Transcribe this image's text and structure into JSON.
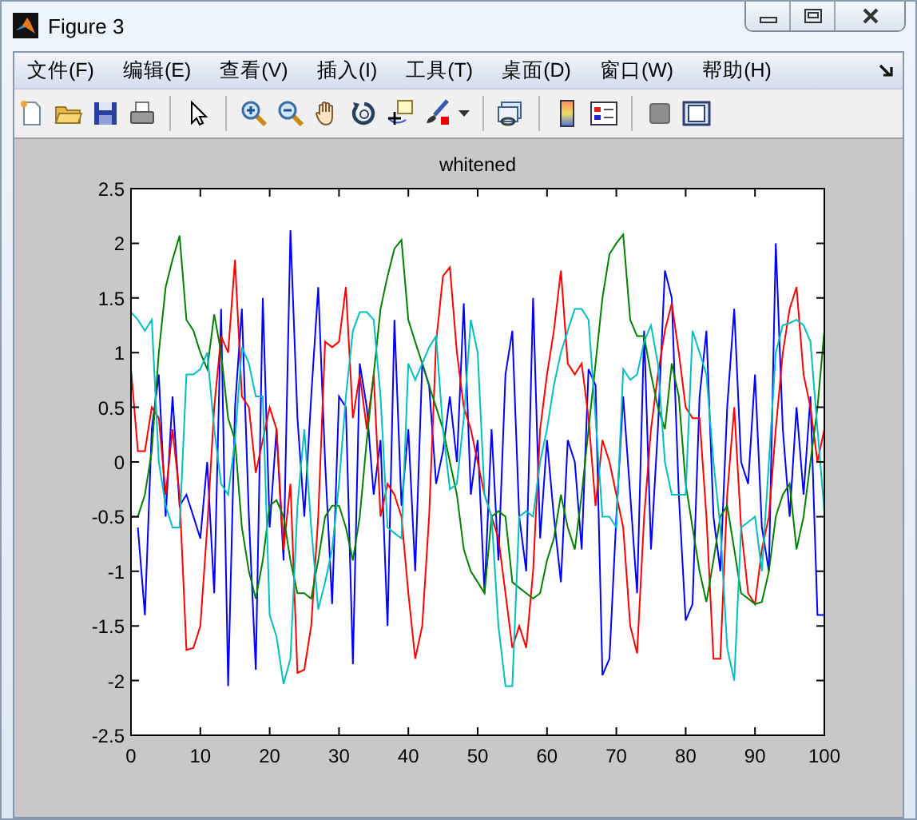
{
  "window": {
    "title": "Figure 3"
  },
  "menu": [
    "文件(F)",
    "编辑(E)",
    "查看(V)",
    "插入(I)",
    "工具(T)",
    "桌面(D)",
    "窗口(W)",
    "帮助(H)"
  ],
  "axes": {
    "chart_data": {
      "type": "line",
      "title": "whitened",
      "xlim": [
        0,
        100
      ],
      "ylim": [
        -2.5,
        2.5
      ],
      "xticks": [
        0,
        10,
        20,
        30,
        40,
        50,
        60,
        70,
        80,
        90,
        100
      ],
      "yticks": [
        -2.5,
        -2,
        -1.5,
        -1,
        -0.5,
        0,
        0.5,
        1,
        1.5,
        2,
        2.5
      ],
      "x": [
        0,
        1,
        2,
        3,
        4,
        5,
        6,
        7,
        8,
        9,
        10,
        11,
        12,
        13,
        14,
        15,
        16,
        17,
        18,
        19,
        20,
        21,
        22,
        23,
        24,
        25,
        26,
        27,
        28,
        29,
        30,
        31,
        32,
        33,
        34,
        35,
        36,
        37,
        38,
        39,
        40,
        41,
        42,
        43,
        44,
        45,
        46,
        47,
        48,
        49,
        50,
        51,
        52,
        53,
        54,
        55,
        56,
        57,
        58,
        59,
        60,
        61,
        62,
        63,
        64,
        65,
        66,
        67,
        68,
        69,
        70,
        71,
        72,
        73,
        74,
        75,
        76,
        77,
        78,
        79,
        80,
        81,
        82,
        83,
        84,
        85,
        86,
        87,
        88,
        89,
        90,
        91,
        92,
        93,
        94,
        95,
        96,
        97,
        98,
        99,
        100
      ],
      "series": [
        {
          "color": "#0000ff",
          "values": [
            null,
            -0.6,
            -1.4,
            0.3,
            0.8,
            -0.5,
            0.6,
            -0.4,
            -0.3,
            -0.5,
            -0.7,
            0.0,
            -1.2,
            1.4,
            -2.05,
            0.5,
            1.4,
            -0.5,
            -1.9,
            1.5,
            -0.6,
            0.3,
            -0.9,
            2.12,
            0.4,
            -0.5,
            0.6,
            1.6,
            0.0,
            -1.3,
            0.6,
            0.5,
            -1.85,
            0.9,
            0.5,
            -0.3,
            0.2,
            -1.5,
            1.3,
            -0.4,
            0.3,
            -1.0,
            0.9,
            0.7,
            -0.2,
            0.1,
            0.6,
            0.0,
            1.45,
            -0.3,
            0.2,
            -1.2,
            0.3,
            -0.9,
            0.8,
            1.2,
            -0.5,
            -1.0,
            1.5,
            -0.7,
            0.2,
            -0.5,
            -1.1,
            0.2,
            0.0,
            -0.8,
            0.85,
            0.7,
            -1.95,
            -1.8,
            -0.5,
            0.6,
            -0.3,
            -1.2,
            1.2,
            -0.8,
            0.3,
            1.75,
            1.5,
            -0.3,
            -1.45,
            -1.3,
            0.6,
            1.2,
            -0.5,
            -1.0,
            0.5,
            1.4,
            0.0,
            -0.2,
            0.8,
            -0.6,
            -1.0,
            2.0,
            0.3,
            -0.5,
            0.5,
            -0.3,
            0.6,
            -1.4,
            -1.4
          ]
        },
        {
          "color": "#ff0000",
          "values": [
            0.85,
            0.1,
            0.1,
            0.5,
            0.4,
            -0.3,
            0.3,
            -0.3,
            -1.72,
            -1.7,
            -1.5,
            -0.6,
            0.5,
            1.15,
            1.0,
            1.85,
            0.6,
            0.5,
            -0.1,
            0.2,
            0.5,
            0.3,
            -0.8,
            -0.2,
            -1.93,
            -1.9,
            -1.5,
            -0.5,
            1.1,
            1.05,
            1.1,
            1.6,
            0.4,
            0.8,
            0.3,
            0.8,
            -0.5,
            -0.2,
            -0.3,
            -0.5,
            -1.2,
            -1.8,
            -1.5,
            -0.5,
            1.1,
            1.7,
            1.78,
            1.0,
            0.5,
            0.3,
            0.0,
            -0.3,
            -0.5,
            -0.7,
            -1.2,
            -1.7,
            -1.5,
            -1.7,
            -1.0,
            0.3,
            0.8,
            1.2,
            1.75,
            0.9,
            0.8,
            0.9,
            0.4,
            -0.4,
            0.2,
            0.0,
            -0.3,
            -0.6,
            -1.5,
            -1.75,
            -0.5,
            0.3,
            0.8,
            1.2,
            1.45,
            1.0,
            0.5,
            0.4,
            0.4,
            -0.5,
            -1.8,
            -1.8,
            -0.3,
            0.5,
            -0.6,
            -1.2,
            -1.3,
            -0.8,
            -0.5,
            0.3,
            1.0,
            1.4,
            1.6,
            0.8,
            0.5,
            0.0,
            0.3
          ]
        },
        {
          "color": "#008000",
          "values": [
            -0.5,
            -0.5,
            -0.3,
            0.1,
            1.0,
            1.6,
            1.85,
            2.07,
            1.3,
            1.2,
            1.0,
            0.85,
            1.35,
            1.0,
            0.4,
            0.2,
            -0.6,
            -1.0,
            -1.25,
            -0.9,
            -0.4,
            -0.35,
            -0.5,
            -0.9,
            -1.2,
            -1.2,
            -1.25,
            -0.9,
            -0.5,
            -0.4,
            -0.4,
            -0.6,
            -0.9,
            -0.5,
            0.2,
            0.8,
            1.4,
            1.7,
            1.95,
            2.03,
            1.3,
            1.1,
            0.9,
            0.7,
            0.5,
            0.3,
            0.0,
            -0.3,
            -0.8,
            -1.0,
            -1.1,
            -1.2,
            -0.5,
            -0.45,
            -0.5,
            -1.1,
            -1.15,
            -1.2,
            -1.25,
            -1.2,
            -0.9,
            -0.7,
            -0.3,
            -0.6,
            -0.8,
            -0.3,
            0.3,
            0.9,
            1.5,
            1.9,
            2.0,
            2.08,
            1.3,
            1.15,
            1.15,
            0.8,
            0.5,
            0.3,
            0.9,
            0.6,
            -0.2,
            -0.6,
            -1.0,
            -1.28,
            -0.9,
            -0.5,
            -0.4,
            -0.8,
            -1.2,
            -1.25,
            -1.3,
            -1.28,
            -1.0,
            -0.5,
            -0.3,
            -0.2,
            -0.8,
            -0.5,
            0.0,
            0.5,
            1.2
          ]
        },
        {
          "color": "#00bfbf",
          "values": [
            1.37,
            1.3,
            1.2,
            1.3,
            0.0,
            -0.4,
            -0.6,
            -0.6,
            0.8,
            0.8,
            0.85,
            1.0,
            0.3,
            -0.2,
            -0.3,
            0.2,
            1.05,
            0.9,
            0.6,
            0.6,
            -1.4,
            -1.6,
            -2.03,
            -1.8,
            -0.4,
            0.3,
            -0.6,
            -1.35,
            -1.1,
            -0.8,
            -0.2,
            0.6,
            1.2,
            1.37,
            1.37,
            1.3,
            0.6,
            -0.6,
            -0.65,
            -0.7,
            0.9,
            0.75,
            0.9,
            1.05,
            1.15,
            0.3,
            -0.25,
            -0.2,
            0.4,
            1.3,
            1.0,
            -0.3,
            -0.5,
            -1.5,
            -2.05,
            -2.05,
            -0.5,
            -0.45,
            -0.5,
            0.0,
            0.3,
            0.7,
            1.0,
            1.2,
            1.4,
            1.4,
            1.3,
            0.4,
            -0.5,
            -0.5,
            -0.6,
            0.85,
            0.75,
            0.8,
            1.1,
            1.25,
            0.9,
            0.0,
            -0.3,
            -0.3,
            -0.3,
            1.2,
            1.0,
            0.8,
            0.0,
            -0.6,
            -1.7,
            -2.0,
            -0.6,
            -0.55,
            -0.5,
            -1.0,
            0.0,
            1.0,
            1.25,
            1.27,
            1.3,
            1.25,
            1.1,
            0.3,
            -0.45
          ]
        }
      ]
    }
  }
}
